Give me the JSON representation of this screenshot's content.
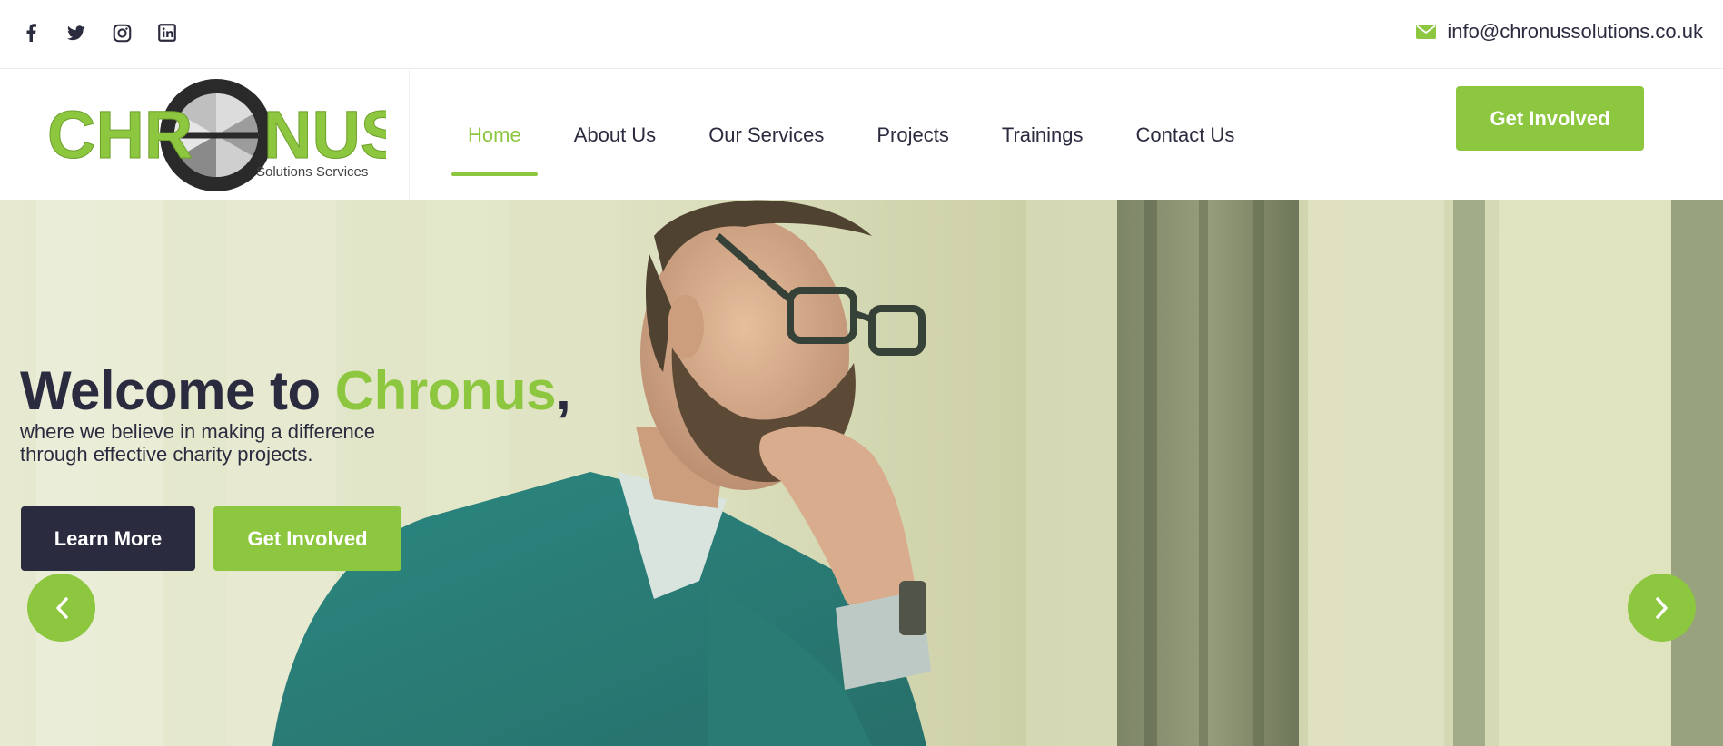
{
  "topbar": {
    "social": [
      {
        "name": "facebook-icon",
        "glyph": "f"
      },
      {
        "name": "twitter-icon",
        "glyph": "twitter"
      },
      {
        "name": "instagram-icon",
        "glyph": "instagram"
      },
      {
        "name": "linkedin-icon",
        "glyph": "in"
      }
    ],
    "email_icon": "envelope-icon",
    "email": "info@chronussolutions.co.uk"
  },
  "header": {
    "logo": {
      "text": "CHRONUS",
      "tagline": "Solutions Services"
    },
    "nav": [
      {
        "label": "Home",
        "active": true
      },
      {
        "label": "About Us",
        "active": false
      },
      {
        "label": "Our Services",
        "active": false
      },
      {
        "label": "Projects",
        "active": false
      },
      {
        "label": "Trainings",
        "active": false
      },
      {
        "label": "Contact Us",
        "active": false
      }
    ],
    "cta_label": "Get Involved"
  },
  "hero": {
    "title_prefix": "Welcome to ",
    "title_brand": "Chronus",
    "title_suffix": ",",
    "subtitle_line1": "where we believe in making a difference",
    "subtitle_line2": "through effective charity projects.",
    "learn_more_label": "Learn More",
    "get_involved_label": "Get Involved",
    "prev_icon": "chevron-left-icon",
    "next_icon": "chevron-right-icon"
  },
  "colors": {
    "accent": "#8dc63f",
    "dark": "#2b2b3f",
    "white": "#ffffff"
  }
}
